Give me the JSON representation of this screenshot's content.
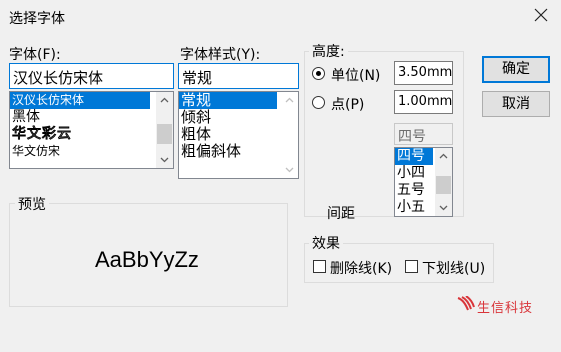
{
  "window": {
    "title": "选择字体"
  },
  "font": {
    "label": "字体(F):",
    "value": "汉仪长仿宋体",
    "items": [
      "汉仪长仿宋体",
      "黑体",
      "华文彩云",
      "华文仿宋"
    ],
    "selected_index": 0
  },
  "style": {
    "label": "字体样式(Y):",
    "value": "常规",
    "items": [
      "常规",
      "倾斜",
      "粗体",
      "粗偏斜体"
    ],
    "selected_index": 0
  },
  "height": {
    "label": "高度:",
    "unit_label": "单位(N)",
    "unit_value": "3.50mm",
    "point_label": "点(P)",
    "point_value": "1.00mm",
    "size_value": "四号",
    "size_items": [
      "四号",
      "小四",
      "五号",
      "小五"
    ],
    "spacing_label": "间距"
  },
  "preview": {
    "label": "预览",
    "sample": "AaBbYyZz"
  },
  "effects": {
    "label": "效果",
    "strikethrough_label": "删除线(K)",
    "underline_label": "下划线(U)"
  },
  "buttons": {
    "ok": "确定",
    "cancel": "取消"
  },
  "brand": {
    "name": "生信科技",
    "color": "#d9353a"
  },
  "colors": {
    "selection": "#0078d7",
    "default_border": "#0078d7"
  }
}
